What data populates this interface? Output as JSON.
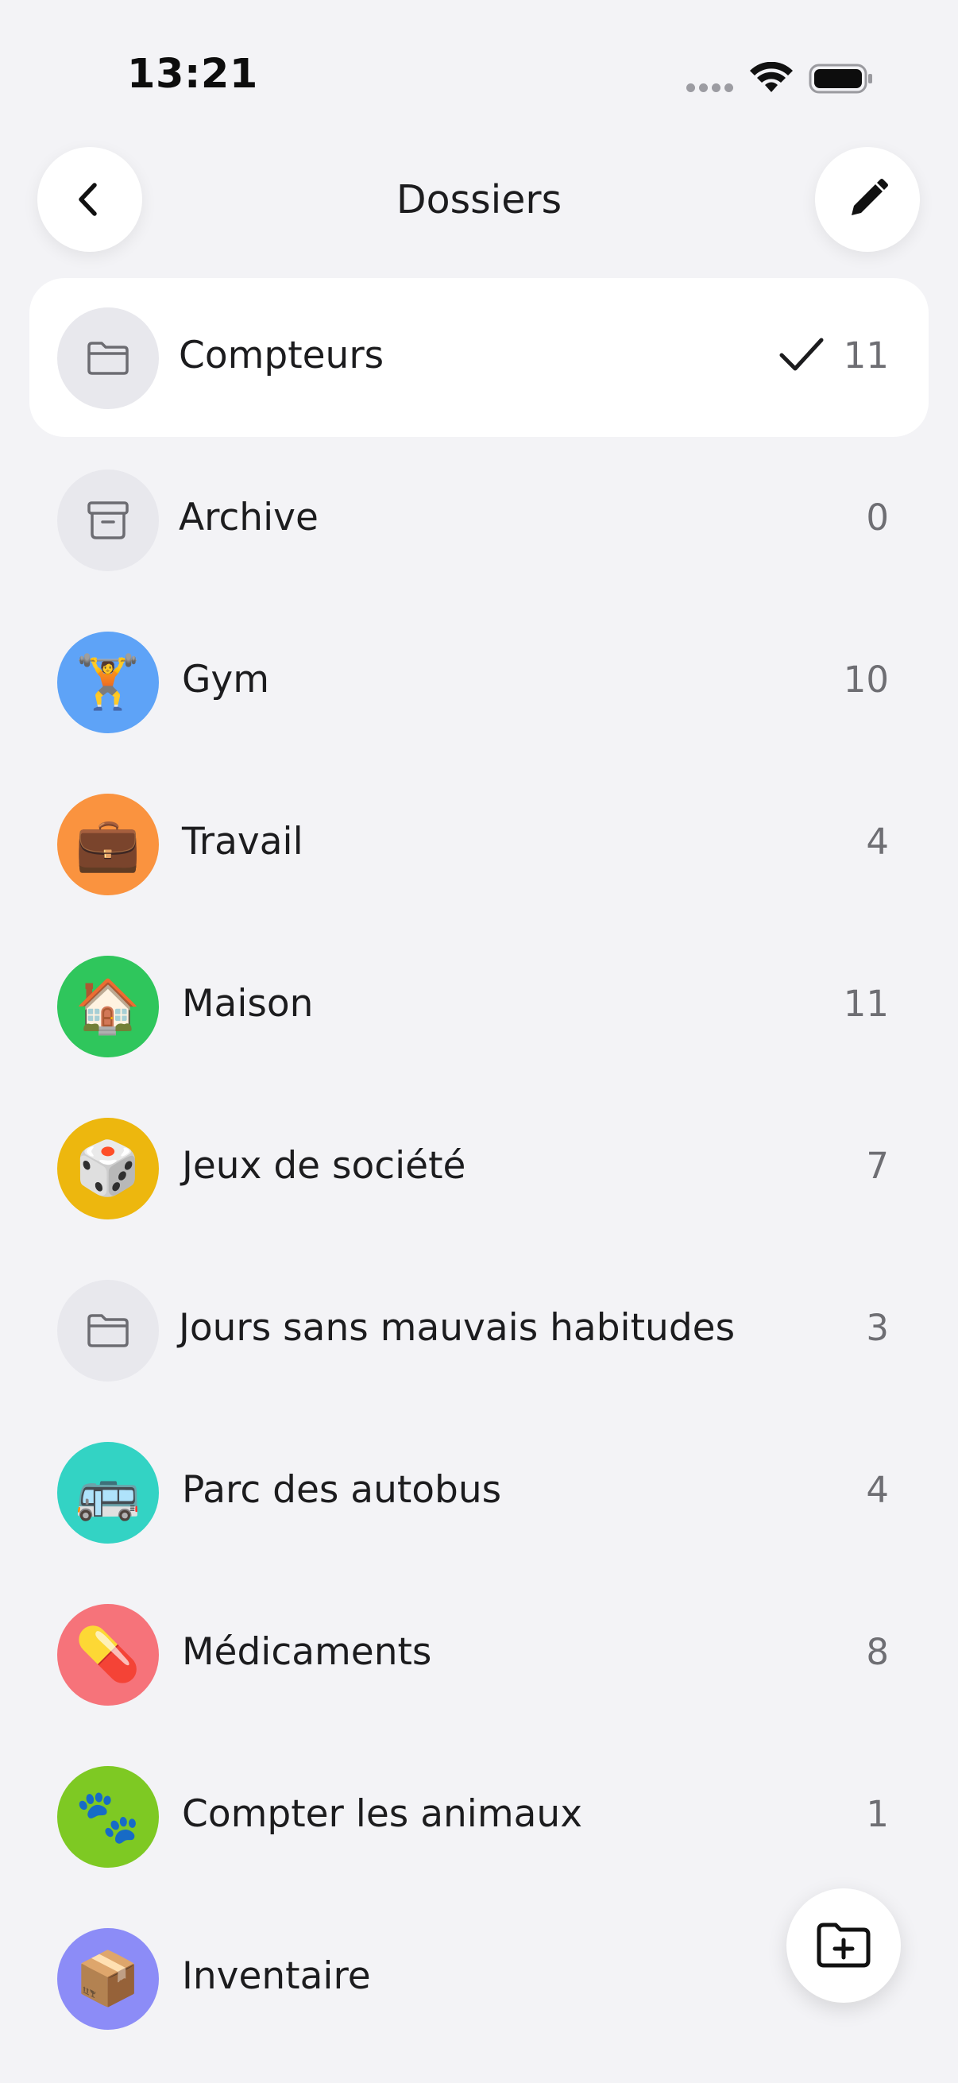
{
  "status_bar": {
    "time": "13:21"
  },
  "nav": {
    "title": "Dossiers",
    "back_icon": "chevron-left-icon",
    "edit_icon": "pencil-icon"
  },
  "folders": [
    {
      "name": "Compteurs",
      "count": "11",
      "icon": "folder-icon",
      "color": "#e8e8ed",
      "selected": true
    },
    {
      "name": "Archive",
      "count": "0",
      "icon": "archive-box-icon",
      "color": "#e8e8ed",
      "selected": false
    },
    {
      "name": "Gym",
      "count": "10",
      "icon": "🏋️",
      "color": "#5ea3f7",
      "selected": false
    },
    {
      "name": "Travail",
      "count": "4",
      "icon": "💼",
      "color": "#fa933f",
      "selected": false
    },
    {
      "name": "Maison",
      "count": "11",
      "icon": "🏠",
      "color": "#2fc65c",
      "selected": false
    },
    {
      "name": "Jeux de société",
      "count": "7",
      "icon": "🎲",
      "color": "#edb70e",
      "selected": false
    },
    {
      "name": "Jours sans mauvais habitudes",
      "count": "3",
      "icon": "folder-icon",
      "color": "#e8e8ed",
      "selected": false
    },
    {
      "name": "Parc des autobus",
      "count": "4",
      "icon": "🚌",
      "color": "#33d3c4",
      "selected": false
    },
    {
      "name": "Médicaments",
      "count": "8",
      "icon": "💊",
      "color": "#f6737a",
      "selected": false
    },
    {
      "name": "Compter les animaux",
      "count": "1",
      "icon": "🐾",
      "color": "#7ec923",
      "selected": false
    },
    {
      "name": "Inventaire",
      "count": "",
      "icon": "📦",
      "color": "#8c8cf7",
      "selected": false
    }
  ],
  "fab": {
    "icon": "folder-plus-icon"
  }
}
